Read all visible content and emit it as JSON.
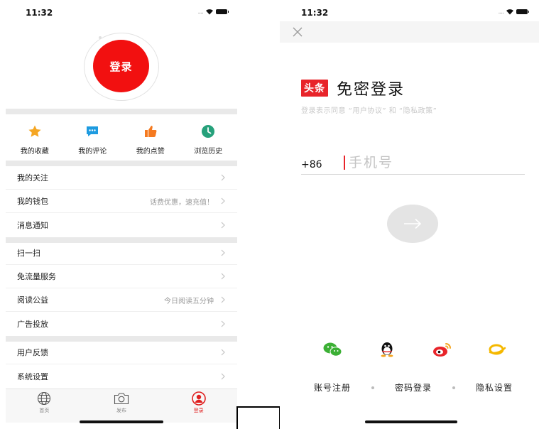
{
  "left": {
    "status_time": "11:32",
    "login_label": "登录",
    "quick_actions": [
      {
        "label": "我的收藏",
        "icon": "star-icon"
      },
      {
        "label": "我的评论",
        "icon": "comment-icon"
      },
      {
        "label": "我的点赞",
        "icon": "thumbs-up-icon"
      },
      {
        "label": "浏览历史",
        "icon": "clock-icon"
      }
    ],
    "menu_group_1": [
      {
        "label": "我的关注",
        "extra": ""
      },
      {
        "label": "我的钱包",
        "extra": "话费优惠，速充值！"
      },
      {
        "label": "消息通知",
        "extra": ""
      }
    ],
    "menu_group_2": [
      {
        "label": "扫一扫",
        "extra": ""
      },
      {
        "label": "免流量服务",
        "extra": ""
      },
      {
        "label": "阅读公益",
        "extra": "今日阅读五分钟"
      },
      {
        "label": "广告投放",
        "extra": ""
      }
    ],
    "menu_group_3": [
      {
        "label": "用户反馈",
        "extra": ""
      },
      {
        "label": "系统设置",
        "extra": ""
      }
    ],
    "tabs": [
      {
        "label": "首页",
        "icon": "globe-icon"
      },
      {
        "label": "发布",
        "icon": "camera-icon"
      },
      {
        "label": "登录",
        "icon": "user-icon",
        "active": true
      }
    ]
  },
  "right": {
    "status_time": "11:32",
    "brand_logo": "头条",
    "title": "免密登录",
    "agreement": "登录表示同意 “用户协议” 和 “隐私政策”",
    "country_code": "+86",
    "phone_placeholder": "手机号",
    "social": [
      "wechat-icon",
      "qq-icon",
      "weibo-icon",
      "tianyi-icon"
    ],
    "links": {
      "register": "账号注册",
      "password_login": "密码登录",
      "privacy": "隐私设置"
    }
  },
  "colors": {
    "accent": "#F21010",
    "brand": "#E8242A",
    "star": "#F5A623",
    "comment": "#1E9BE0",
    "like": "#F57A20",
    "history": "#26A17B"
  }
}
